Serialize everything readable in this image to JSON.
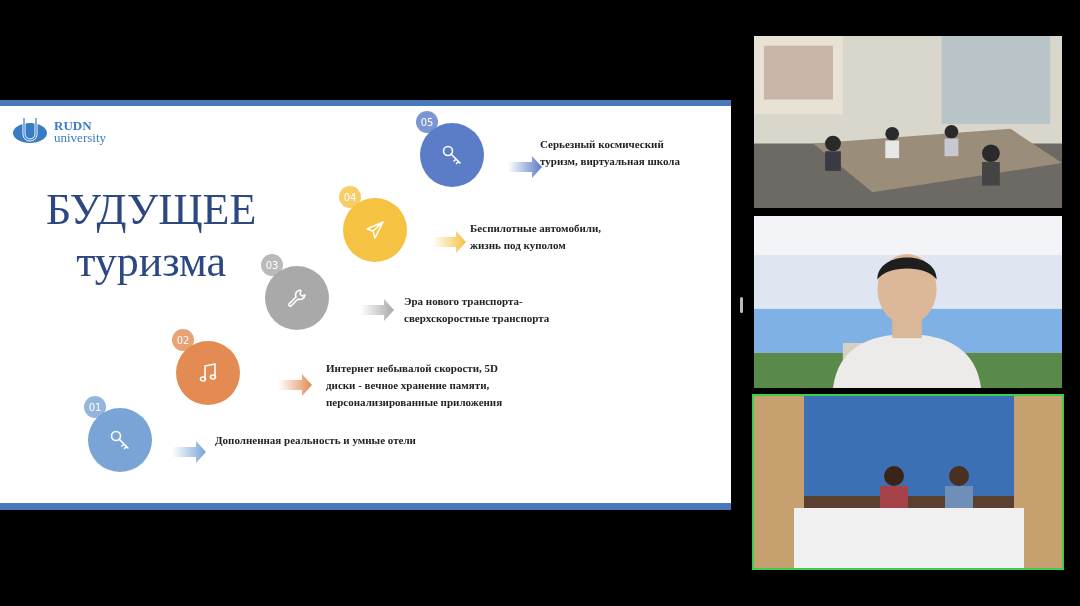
{
  "slide": {
    "logo": {
      "line1": "RUDN",
      "line2": "university"
    },
    "title": [
      "БУДУЩЕЕ",
      "туризма"
    ],
    "steps": [
      {
        "number": "05",
        "kind": "key",
        "color": "#5b7cc7",
        "lines": [
          "Серьезный космический",
          "туризм, виртуальная школа"
        ]
      },
      {
        "number": "04",
        "kind": "plane",
        "color": "#f5c242",
        "lines": [
          "Беспилотные автомобили,",
          "жизнь под куполом"
        ]
      },
      {
        "number": "03",
        "kind": "wrench",
        "color": "#a9a9a9",
        "lines": [
          "Эра нового транспорта-",
          "сверхскоростные транспорта"
        ]
      },
      {
        "number": "02",
        "kind": "music",
        "color": "#e38b52",
        "lines": [
          "Интернет небывалой скорости, 5D",
          "диски - вечное хранение памяти,",
          "персонализированные приложения"
        ]
      },
      {
        "number": "01",
        "kind": "key",
        "color": "#7aa3d6",
        "lines": [
          "Дополненная реальность и умные отели"
        ]
      }
    ]
  },
  "video_tiles": [
    {
      "kind": "picture",
      "active": false
    },
    {
      "kind": "picture",
      "active": false
    },
    {
      "kind": "picture",
      "active": true
    }
  ]
}
